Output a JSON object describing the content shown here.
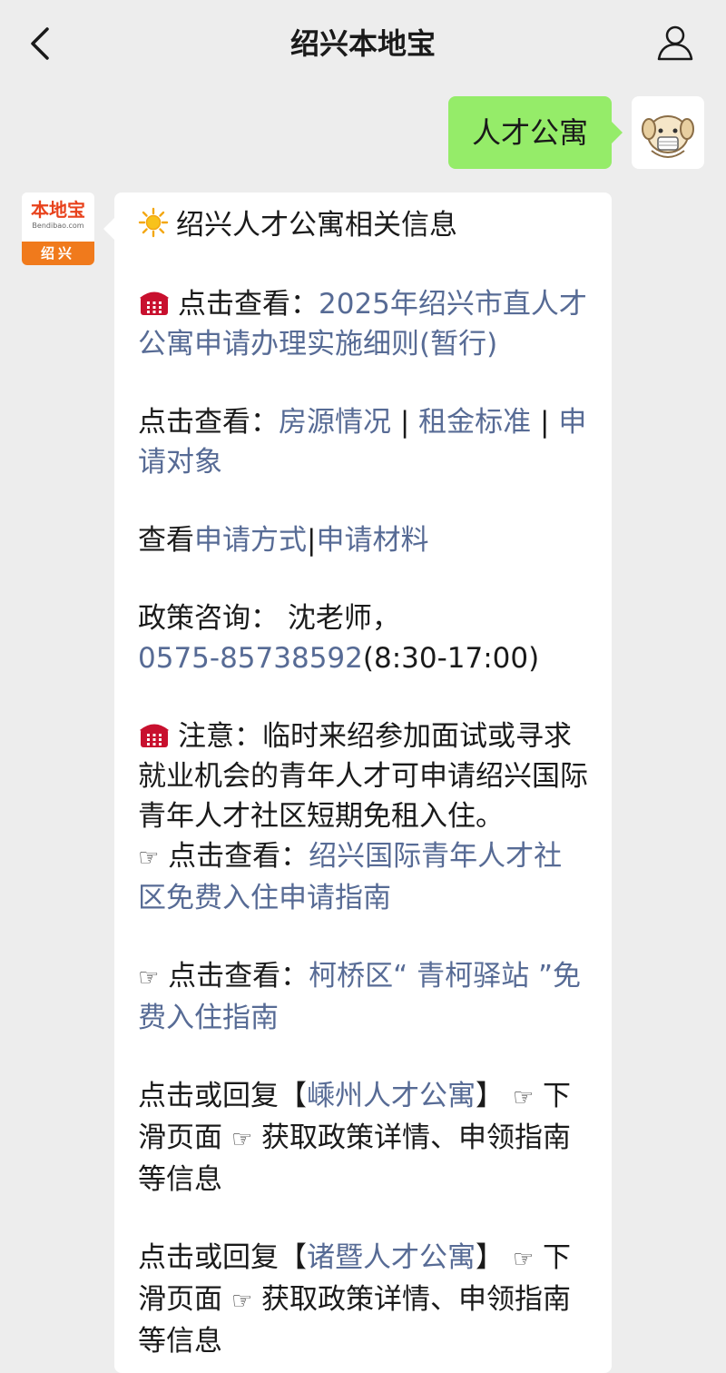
{
  "header": {
    "title": "绍兴本地宝"
  },
  "sent_message": {
    "text": "人才公寓"
  },
  "bot": {
    "logo_main": "本地宝",
    "logo_sub": "Bendibao.com",
    "logo_city": "绍兴"
  },
  "reply": {
    "heading": "绍兴人才公寓相关信息",
    "p1_prefix": "点击查看：",
    "p1_link": "2025年绍兴市直人才公寓申请办理实施细则(暂行)",
    "p2_prefix": "点击查看：",
    "p2_link1": "房源情况",
    "sep": "|",
    "p2_link2": "租金标准",
    "p2_link3": "申请对象",
    "p3_prefix": "查看",
    "p3_link1": "申请方式",
    "p3_link2": "申请材料",
    "p4_prefix": "政策咨询：  沈老师，",
    "p4_phone": "0575-85738592",
    "p4_hours": "(8:30-17:00)",
    "p5_text": "注意：临时来绍参加面试或寻求就业机会的青年人才可申请绍兴国际青年人才社区短期免租入住。",
    "p5_prefix": "点击查看：",
    "p5_link": "绍兴国际青年人才社区免费入住申请指南",
    "p6_prefix": "点击查看：",
    "p6_link": "柯桥区“ 青柯驿站 ”免费入住指南",
    "p7_prefix": "点击或回复【",
    "p7_link": "嵊州人才公寓",
    "p7_suffix": "】",
    "p7_mid": "下滑页面",
    "p7_end": "获取政策详情、申领指南等信息",
    "p8_prefix": "点击或回复【",
    "p8_link": "诸暨人才公寓",
    "p8_suffix": "】",
    "p8_mid": "下滑页面",
    "p8_end": "获取政策详情、申领指南等信息"
  }
}
